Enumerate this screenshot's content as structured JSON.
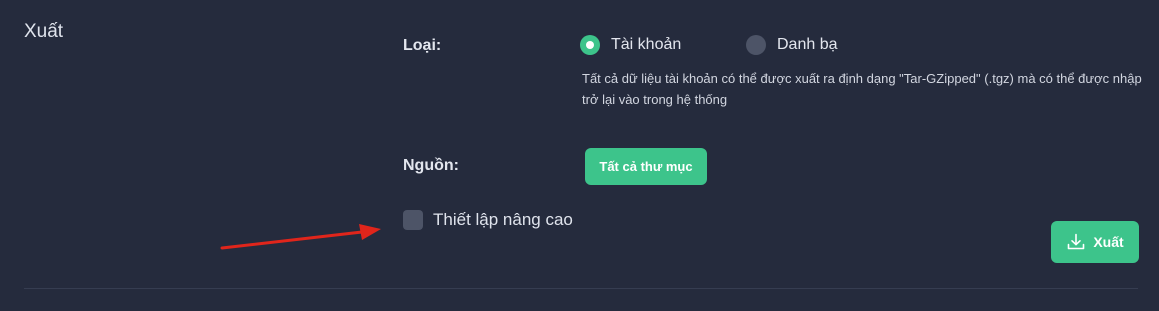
{
  "section": {
    "title": "Xuất"
  },
  "type": {
    "label": "Loại:",
    "options": [
      {
        "label": "Tài khoản",
        "selected": true
      },
      {
        "label": "Danh bạ",
        "selected": false
      }
    ],
    "description": "Tất cả dữ liệu tài khoản có thể được xuất ra định dạng \"Tar-GZipped\" (.tgz) mà có thể được nhập trở lại vào trong hệ thống"
  },
  "source": {
    "label": "Nguồn:",
    "button_label": "Tất cả thư mục"
  },
  "advanced": {
    "label": "Thiết lập nâng cao",
    "checked": false
  },
  "export": {
    "button_label": "Xuất",
    "icon": "download-icon"
  },
  "colors": {
    "background": "#252b3d",
    "accent": "#3dc48b",
    "control_inactive": "#4d5467",
    "annotation_arrow": "#e0251b"
  }
}
